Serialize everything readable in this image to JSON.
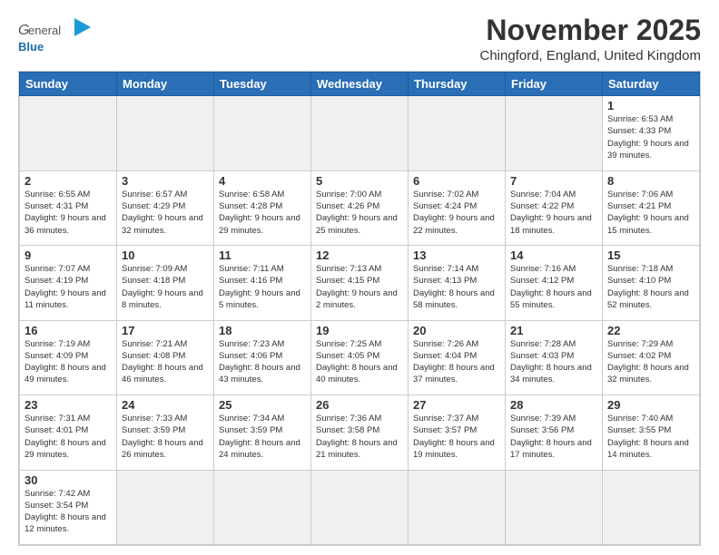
{
  "header": {
    "logo_general": "General",
    "logo_blue": "Blue",
    "title": "November 2025",
    "subtitle": "Chingford, England, United Kingdom"
  },
  "weekdays": [
    "Sunday",
    "Monday",
    "Tuesday",
    "Wednesday",
    "Thursday",
    "Friday",
    "Saturday"
  ],
  "weeks": [
    [
      {
        "date": "",
        "info": "",
        "empty": true
      },
      {
        "date": "",
        "info": "",
        "empty": true
      },
      {
        "date": "",
        "info": "",
        "empty": true
      },
      {
        "date": "",
        "info": "",
        "empty": true
      },
      {
        "date": "",
        "info": "",
        "empty": true
      },
      {
        "date": "",
        "info": "",
        "empty": true
      },
      {
        "date": "1",
        "info": "Sunrise: 6:53 AM\nSunset: 4:33 PM\nDaylight: 9 hours\nand 39 minutes.",
        "empty": false
      }
    ],
    [
      {
        "date": "2",
        "info": "Sunrise: 6:55 AM\nSunset: 4:31 PM\nDaylight: 9 hours\nand 36 minutes.",
        "empty": false
      },
      {
        "date": "3",
        "info": "Sunrise: 6:57 AM\nSunset: 4:29 PM\nDaylight: 9 hours\nand 32 minutes.",
        "empty": false
      },
      {
        "date": "4",
        "info": "Sunrise: 6:58 AM\nSunset: 4:28 PM\nDaylight: 9 hours\nand 29 minutes.",
        "empty": false
      },
      {
        "date": "5",
        "info": "Sunrise: 7:00 AM\nSunset: 4:26 PM\nDaylight: 9 hours\nand 25 minutes.",
        "empty": false
      },
      {
        "date": "6",
        "info": "Sunrise: 7:02 AM\nSunset: 4:24 PM\nDaylight: 9 hours\nand 22 minutes.",
        "empty": false
      },
      {
        "date": "7",
        "info": "Sunrise: 7:04 AM\nSunset: 4:22 PM\nDaylight: 9 hours\nand 18 minutes.",
        "empty": false
      },
      {
        "date": "8",
        "info": "Sunrise: 7:06 AM\nSunset: 4:21 PM\nDaylight: 9 hours\nand 15 minutes.",
        "empty": false
      }
    ],
    [
      {
        "date": "9",
        "info": "Sunrise: 7:07 AM\nSunset: 4:19 PM\nDaylight: 9 hours\nand 11 minutes.",
        "empty": false
      },
      {
        "date": "10",
        "info": "Sunrise: 7:09 AM\nSunset: 4:18 PM\nDaylight: 9 hours\nand 8 minutes.",
        "empty": false
      },
      {
        "date": "11",
        "info": "Sunrise: 7:11 AM\nSunset: 4:16 PM\nDaylight: 9 hours\nand 5 minutes.",
        "empty": false
      },
      {
        "date": "12",
        "info": "Sunrise: 7:13 AM\nSunset: 4:15 PM\nDaylight: 9 hours\nand 2 minutes.",
        "empty": false
      },
      {
        "date": "13",
        "info": "Sunrise: 7:14 AM\nSunset: 4:13 PM\nDaylight: 8 hours\nand 58 minutes.",
        "empty": false
      },
      {
        "date": "14",
        "info": "Sunrise: 7:16 AM\nSunset: 4:12 PM\nDaylight: 8 hours\nand 55 minutes.",
        "empty": false
      },
      {
        "date": "15",
        "info": "Sunrise: 7:18 AM\nSunset: 4:10 PM\nDaylight: 8 hours\nand 52 minutes.",
        "empty": false
      }
    ],
    [
      {
        "date": "16",
        "info": "Sunrise: 7:19 AM\nSunset: 4:09 PM\nDaylight: 8 hours\nand 49 minutes.",
        "empty": false
      },
      {
        "date": "17",
        "info": "Sunrise: 7:21 AM\nSunset: 4:08 PM\nDaylight: 8 hours\nand 46 minutes.",
        "empty": false
      },
      {
        "date": "18",
        "info": "Sunrise: 7:23 AM\nSunset: 4:06 PM\nDaylight: 8 hours\nand 43 minutes.",
        "empty": false
      },
      {
        "date": "19",
        "info": "Sunrise: 7:25 AM\nSunset: 4:05 PM\nDaylight: 8 hours\nand 40 minutes.",
        "empty": false
      },
      {
        "date": "20",
        "info": "Sunrise: 7:26 AM\nSunset: 4:04 PM\nDaylight: 8 hours\nand 37 minutes.",
        "empty": false
      },
      {
        "date": "21",
        "info": "Sunrise: 7:28 AM\nSunset: 4:03 PM\nDaylight: 8 hours\nand 34 minutes.",
        "empty": false
      },
      {
        "date": "22",
        "info": "Sunrise: 7:29 AM\nSunset: 4:02 PM\nDaylight: 8 hours\nand 32 minutes.",
        "empty": false
      }
    ],
    [
      {
        "date": "23",
        "info": "Sunrise: 7:31 AM\nSunset: 4:01 PM\nDaylight: 8 hours\nand 29 minutes.",
        "empty": false
      },
      {
        "date": "24",
        "info": "Sunrise: 7:33 AM\nSunset: 3:59 PM\nDaylight: 8 hours\nand 26 minutes.",
        "empty": false
      },
      {
        "date": "25",
        "info": "Sunrise: 7:34 AM\nSunset: 3:59 PM\nDaylight: 8 hours\nand 24 minutes.",
        "empty": false
      },
      {
        "date": "26",
        "info": "Sunrise: 7:36 AM\nSunset: 3:58 PM\nDaylight: 8 hours\nand 21 minutes.",
        "empty": false
      },
      {
        "date": "27",
        "info": "Sunrise: 7:37 AM\nSunset: 3:57 PM\nDaylight: 8 hours\nand 19 minutes.",
        "empty": false
      },
      {
        "date": "28",
        "info": "Sunrise: 7:39 AM\nSunset: 3:56 PM\nDaylight: 8 hours\nand 17 minutes.",
        "empty": false
      },
      {
        "date": "29",
        "info": "Sunrise: 7:40 AM\nSunset: 3:55 PM\nDaylight: 8 hours\nand 14 minutes.",
        "empty": false
      }
    ],
    [
      {
        "date": "30",
        "info": "Sunrise: 7:42 AM\nSunset: 3:54 PM\nDaylight: 8 hours\nand 12 minutes.",
        "empty": false
      },
      {
        "date": "",
        "info": "",
        "empty": true
      },
      {
        "date": "",
        "info": "",
        "empty": true
      },
      {
        "date": "",
        "info": "",
        "empty": true
      },
      {
        "date": "",
        "info": "",
        "empty": true
      },
      {
        "date": "",
        "info": "",
        "empty": true
      },
      {
        "date": "",
        "info": "",
        "empty": true
      }
    ]
  ]
}
